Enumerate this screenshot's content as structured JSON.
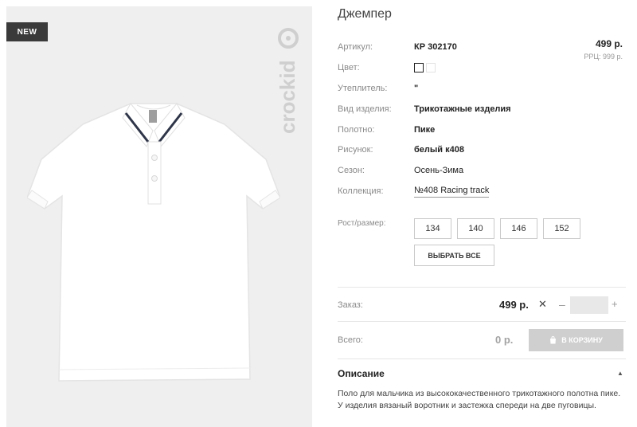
{
  "product": {
    "badge": "NEW",
    "brand": "crockid",
    "title": "Джемпер",
    "price": "499 р.",
    "rrp": "РРЦ: 999 р."
  },
  "details": [
    {
      "label": "Артикул:",
      "value": "КР 302170"
    },
    {
      "label": "Цвет:",
      "value": ""
    },
    {
      "label": "Утеплитель:",
      "value": "\""
    },
    {
      "label": "Вид изделия:",
      "value": "Трикотажные изделия"
    },
    {
      "label": "Полотно:",
      "value": "Пике"
    },
    {
      "label": "Рисунок:",
      "value": "белый к408"
    },
    {
      "label": "Сезон:",
      "value": "Осень-Зима"
    },
    {
      "label": "Коллекция:",
      "value": "№408 Racing track"
    }
  ],
  "size": {
    "label": "Рост/размер:",
    "options": [
      "134",
      "140",
      "146",
      "152"
    ],
    "select_all": "ВЫБРАТЬ ВСЕ"
  },
  "order": {
    "label": "Заказ:",
    "price": "499 р.",
    "times": "✕",
    "minus": "–",
    "plus": "+",
    "quantity": ""
  },
  "total": {
    "label": "Всего:",
    "value": "0 р.",
    "cart_button": "В КОРЗИНУ"
  },
  "description": {
    "title": "Описание",
    "text": "Поло для мальчика из высококачественного трикотажного полотна пике. У изделия вязаный воротник и застежка спереди на две пуговицы."
  },
  "colors": {
    "badge_bg": "#3a3a3a",
    "photo_bg": "#f0efef",
    "cart_disabled": "#cfcfcf"
  }
}
